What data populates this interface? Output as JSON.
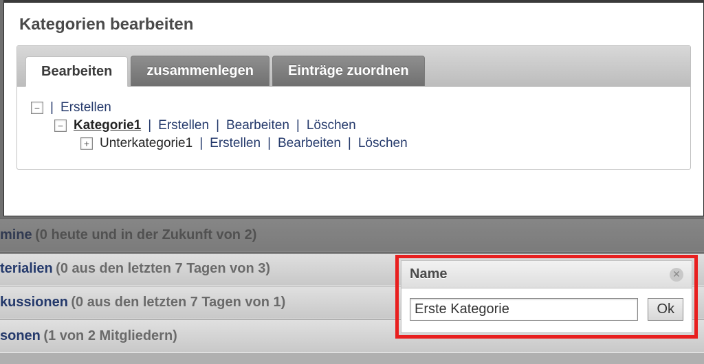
{
  "modal": {
    "title": "Kategorien bearbeiten",
    "tabs": {
      "edit": "Bearbeiten",
      "merge": "zusammenlegen",
      "assign": "Einträge zuordnen"
    },
    "tree": {
      "root_create": "Erstellen",
      "cat1": {
        "name": "Kategorie1",
        "create": "Erstellen",
        "edit": "Bearbeiten",
        "del": "Löschen"
      },
      "sub1": {
        "name": "Unterkategorie1",
        "create": "Erstellen",
        "edit": "Bearbeiten",
        "del": "Löschen"
      }
    }
  },
  "sections": {
    "mine": {
      "label": "mine",
      "count": "(0 heute und in der Zukunft von 2)"
    },
    "terialien": {
      "label": "terialien",
      "count": "(0 aus den letzten 7 Tagen von 3)"
    },
    "kussionen": {
      "label": "kussionen",
      "count": "(0 aus den letzten 7 Tagen von 1)"
    },
    "sonen": {
      "label": "sonen",
      "count": "(1 von 2 Mitgliedern)"
    }
  },
  "name_dialog": {
    "title": "Name",
    "value": "Erste Kategorie",
    "ok": "Ok"
  },
  "glyphs": {
    "minus": "−",
    "plus": "+",
    "pipe": "|",
    "close_x": "✕"
  }
}
